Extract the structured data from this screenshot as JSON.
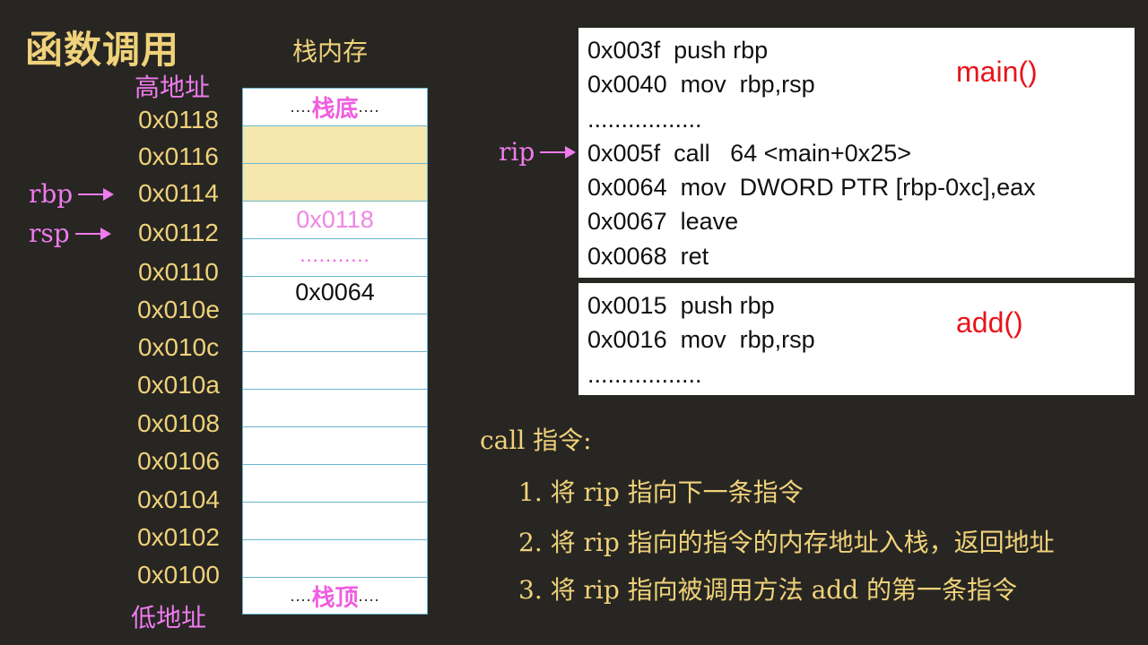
{
  "title": "函数调用",
  "stack_title": "栈内存",
  "high_addr_label": "高地址",
  "low_addr_label": "低地址",
  "addresses": [
    "0x0118",
    "0x0116",
    "0x0114",
    "0x0112",
    "0x0110",
    "0x010e",
    "0x010c",
    "0x010a",
    "0x0108",
    "0x0106",
    "0x0104",
    "0x0102",
    "0x0100"
  ],
  "registers": {
    "rbp": "rbp",
    "rsp": "rsp",
    "rip": "rip"
  },
  "stack": {
    "bottom_label": "栈底",
    "top_label": "栈顶",
    "bottom_dots_left": "....",
    "bottom_dots_right": "....",
    "top_dots_left": "....",
    "top_dots_right": "....",
    "saved_rbp": "0x0118",
    "dots": "...........",
    "return_addr": "0x0064"
  },
  "main_code": {
    "label": "main()",
    "lines": [
      "0x003f  push rbp",
      "0x0040  mov  rbp,rsp",
      ".................",
      "0x005f  call   64 <main+0x25>",
      "0x0064  mov  DWORD PTR [rbp-0xc],eax",
      "0x0067  leave",
      "0x0068  ret"
    ]
  },
  "add_code": {
    "label": "add()",
    "lines": [
      "0x0015  push rbp",
      "0x0016  mov  rbp,rsp",
      "................."
    ]
  },
  "notes": {
    "heading": "call 指令:",
    "items": [
      "1. 将 rip 指向下一条指令",
      "2. 将 rip 指向的指令的内存地址入栈，返回地址",
      "3. 将 rip 指向被调用方法 add 的第一条指令"
    ]
  },
  "colors": {
    "background": "#282622",
    "gold": "#efd27a",
    "pink": "#ef7bef",
    "red": "#e8141b",
    "highlight": "#f5e7ad",
    "grid": "#6ab7d0"
  }
}
